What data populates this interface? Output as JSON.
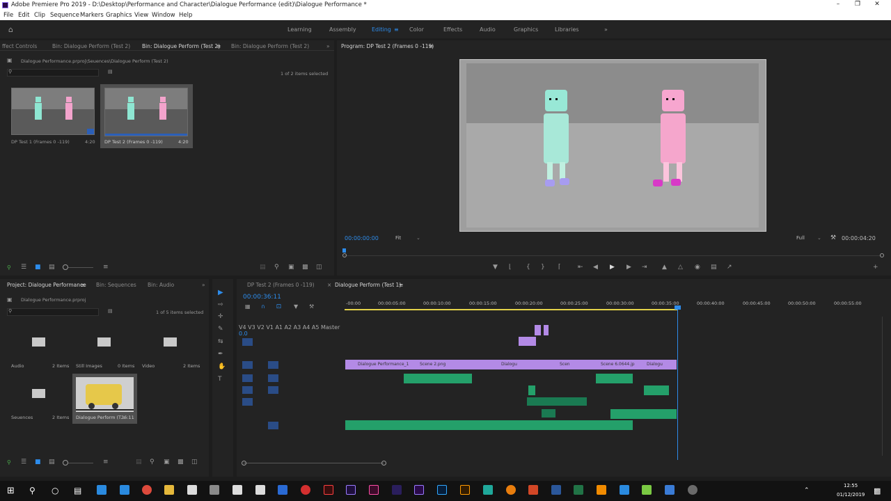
{
  "window": {
    "title": "Adobe Premiere Pro 2019 - D:\\Desktop\\Performance and Character\\Dialogue Performance (edit)\\Dialogue Performance *"
  },
  "menu": [
    "File",
    "Edit",
    "Clip",
    "Sequence",
    "Markers",
    "Graphics",
    "View",
    "Window",
    "Help"
  ],
  "workspaces": [
    "Learning",
    "Assembly",
    "Editing",
    "Color",
    "Effects",
    "Audio",
    "Graphics",
    "Libraries"
  ],
  "active_workspace": "Editing",
  "source_panel": {
    "tabs": [
      "ffect Controls",
      "Bin: Dialogue Perform (Test 2)",
      "Bin: Dialogue Perform (Test 2)",
      "Bin: Dialogue Perform (Test 2)"
    ],
    "path": "Dialogue Performance.prproj\\Seuences\\Dialogue Perform (Test 2)",
    "selection": "1 of 2 items selected",
    "items": [
      {
        "name": "DP Test 1 (Frames 0 -119)",
        "duration": "4:20"
      },
      {
        "name": "DP Test 2 (Frames 0 -119)",
        "duration": "4:20"
      }
    ]
  },
  "program": {
    "title": "Program: DP Test 2 (Frames 0 -119)",
    "timecode": "00:00:00:00",
    "fit": "Fit",
    "quality": "Full",
    "duration": "00:00:04:20"
  },
  "project_panel": {
    "tabs": [
      "Project: Dialogue Performance",
      "Bin: Sequences",
      "Bin: Audio"
    ],
    "file": "Dialogue Performance.prproj",
    "selection": "1 of 5 items selected",
    "items": [
      {
        "name": "Audio",
        "count": "2 Items"
      },
      {
        "name": "Still Images",
        "count": "0 Items"
      },
      {
        "name": "Video",
        "count": "2 Items"
      },
      {
        "name": "Seuences",
        "count": "2 Items"
      },
      {
        "name": "Dialogue Perform (T...",
        "count": "36:11"
      }
    ]
  },
  "timeline": {
    "tabs": [
      "DP Test 2 (Frames 0 -119)",
      "Dialogue Perform (Test 1)"
    ],
    "timecode": "00:00:36:11",
    "ruler": [
      "-00:00",
      "00:00:05:00",
      "00:00:10:00",
      "00:00:15:00",
      "00:00:20:00",
      "00:00:25:00",
      "00:00:30:00",
      "00:00:35:00",
      "00:00:40:00",
      "00:00:45:00",
      "00:00:50:00",
      "00:00:55:00"
    ],
    "video_tracks": [
      "V4",
      "V3",
      "V2",
      "V1"
    ],
    "audio_tracks": [
      "A1",
      "A2",
      "A3",
      "A4",
      "A5"
    ],
    "master": "Master",
    "master_value": "0.0",
    "clips": [
      "Dialogue Performance_1",
      "Scene 2.png",
      "Dialogu",
      "Scen",
      "Scene 6.0644.jp",
      "Dialogu"
    ]
  },
  "taskbar": {
    "time": "12:55",
    "date": "01/12/2019"
  },
  "colors": {
    "accent": "#2d8ceb",
    "video_clip": "#b38ae6",
    "audio_clip": "#24a06a"
  }
}
